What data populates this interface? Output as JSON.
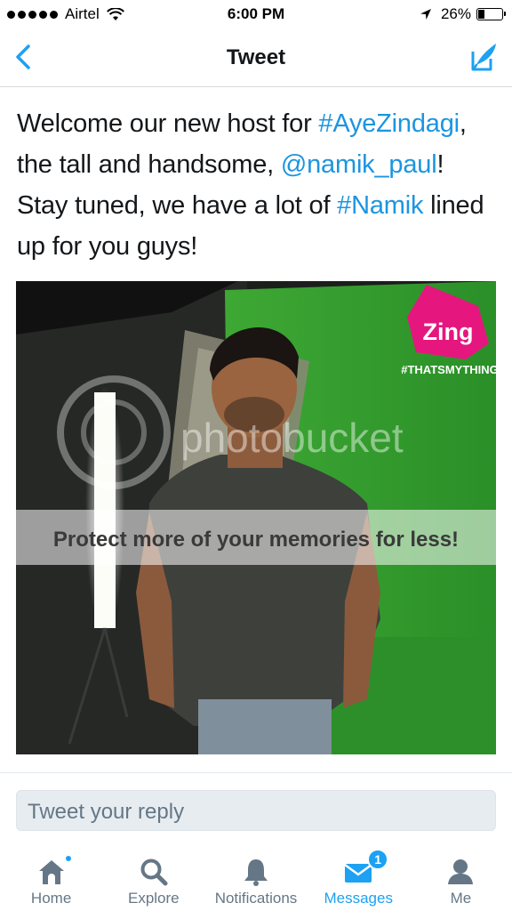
{
  "status_bar": {
    "carrier": "Airtel",
    "time": "6:00 PM",
    "battery": "26%"
  },
  "nav": {
    "title": "Tweet"
  },
  "tweet": {
    "segments": [
      {
        "text": "Welcome our new host for ",
        "type": "text"
      },
      {
        "text": "#AyeZindagi",
        "type": "link"
      },
      {
        "text": ", the tall and handsome, ",
        "type": "text"
      },
      {
        "text": "@namik_paul",
        "type": "link"
      },
      {
        "text": "! Stay tuned, we have a lot of ",
        "type": "text"
      },
      {
        "text": "#Namik",
        "type": "link"
      },
      {
        "text": " lined up for you guys!",
        "type": "text"
      }
    ]
  },
  "media": {
    "logo_text": "Zing",
    "tagline": "#THATSMYTHING",
    "watermark": "photobucket",
    "banner": "Protect more of your memories for less!",
    "colors": {
      "green_screen": "#2f9a2c",
      "zing_pink": "#e5177e"
    }
  },
  "reply": {
    "placeholder": "Tweet your reply"
  },
  "tabs": [
    {
      "label": "Home",
      "icon": "home-icon",
      "dot": true
    },
    {
      "label": "Explore",
      "icon": "search-icon"
    },
    {
      "label": "Notifications",
      "icon": "bell-icon"
    },
    {
      "label": "Messages",
      "icon": "envelope-icon",
      "active": true,
      "badge": "1"
    },
    {
      "label": "Me",
      "icon": "person-icon"
    }
  ],
  "colors": {
    "accent": "#1da1f2",
    "link": "#1b95e0",
    "muted": "#657786"
  }
}
